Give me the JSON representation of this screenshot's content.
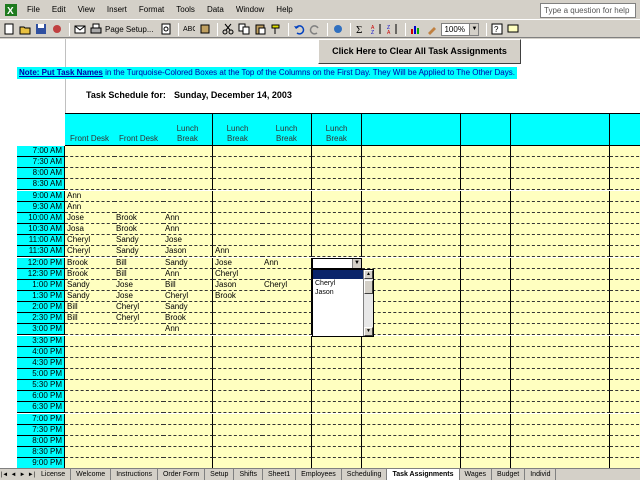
{
  "menu": {
    "items": [
      "File",
      "Edit",
      "View",
      "Insert",
      "Format",
      "Tools",
      "Data",
      "Window",
      "Help"
    ],
    "help_placeholder": "Type a question for help"
  },
  "toolbar": {
    "page_setup_label": "Page Setup...",
    "zoom": "100%",
    "icons": [
      "new-icon",
      "open-icon",
      "save-icon",
      "permission-icon",
      "email-icon",
      "print-icon",
      "print-preview-icon",
      "spelling-icon",
      "research-icon",
      "cut-icon",
      "copy-icon",
      "paste-icon",
      "format-painter-icon",
      "undo-icon",
      "redo-icon",
      "hyperlink-icon",
      "autosum-icon",
      "sort-ascending-icon",
      "sort-descending-icon",
      "chart-wizard-icon",
      "drawing-icon",
      "help-icon",
      "comment-icon"
    ]
  },
  "sheet": {
    "clear_button": "Click Here to Clear All Task Assignments",
    "note_bold": "Note: Put Task Names",
    "note_rest": " in the Turquoise-Colored Boxes at the Top of the Columns on the First Day. They Will be Applied to The Other Days.",
    "schedule_label": "Task Schedule for:",
    "schedule_date": "Sunday, December 14, 2003",
    "columns": [
      {
        "line1": "",
        "line2": "Front Desk"
      },
      {
        "line1": "",
        "line2": "Front Desk"
      },
      {
        "line1": "Lunch",
        "line2": "Break"
      },
      {
        "line1": "Lunch",
        "line2": "Break"
      },
      {
        "line1": "Lunch",
        "line2": "Break"
      },
      {
        "line1": "Lunch",
        "line2": "Break"
      },
      {
        "line1": "",
        "line2": ""
      },
      {
        "line1": "",
        "line2": ""
      },
      {
        "line1": "",
        "line2": ""
      },
      {
        "line1": "",
        "line2": ""
      },
      {
        "line1": "",
        "line2": ""
      },
      {
        "line1": "",
        "line2": ""
      }
    ],
    "rows": [
      {
        "time": "7:00 AM",
        "cells": [
          "",
          "",
          "",
          "",
          "",
          ""
        ]
      },
      {
        "time": "7:30 AM",
        "cells": [
          "",
          "",
          "",
          "",
          "",
          ""
        ]
      },
      {
        "time": "8:00 AM",
        "cells": [
          "",
          "",
          "",
          "",
          "",
          ""
        ]
      },
      {
        "time": "8:30 AM",
        "cells": [
          "",
          "",
          "",
          "",
          "",
          ""
        ]
      },
      {
        "time": "9:00 AM",
        "cells": [
          "Ann",
          "",
          "",
          "",
          "",
          ""
        ]
      },
      {
        "time": "9:30 AM",
        "cells": [
          "Ann",
          "",
          "",
          "",
          "",
          ""
        ]
      },
      {
        "time": "10:00 AM",
        "cells": [
          "Jose",
          "Brook",
          "Ann",
          "",
          "",
          ""
        ]
      },
      {
        "time": "10:30 AM",
        "cells": [
          "Josa",
          "Brook",
          "Ann",
          "",
          "",
          ""
        ]
      },
      {
        "time": "11:00 AM",
        "cells": [
          "Cheryl",
          "Sandy",
          "Jose",
          "",
          "",
          ""
        ]
      },
      {
        "time": "11:30 AM",
        "cells": [
          "Cheryl",
          "Sandy",
          "Jason",
          "Ann",
          "",
          ""
        ]
      },
      {
        "time": "12:00 PM",
        "cells": [
          "Brook",
          "Bill",
          "Sandy",
          "Jose",
          "Ann",
          ""
        ]
      },
      {
        "time": "12:30 PM",
        "cells": [
          "Brook",
          "Bill",
          "Ann",
          "Cheryl",
          "",
          ""
        ]
      },
      {
        "time": "1:00 PM",
        "cells": [
          "Sandy",
          "Jose",
          "Bill",
          "Jason",
          "Cheryl",
          ""
        ]
      },
      {
        "time": "1:30 PM",
        "cells": [
          "Sandy",
          "Jose",
          "Cheryl",
          "Brook",
          "",
          ""
        ]
      },
      {
        "time": "2:00 PM",
        "cells": [
          "Bill",
          "Cheryl",
          "Sandy",
          "",
          "",
          ""
        ]
      },
      {
        "time": "2:30 PM",
        "cells": [
          "Bill",
          "Cheryl",
          "Brook",
          "",
          "",
          ""
        ]
      },
      {
        "time": "3:00 PM",
        "cells": [
          "",
          "",
          "Ann",
          "",
          "",
          ""
        ]
      },
      {
        "time": "3:30 PM",
        "cells": [
          "",
          "",
          "",
          "",
          "",
          ""
        ]
      },
      {
        "time": "4:00 PM",
        "cells": [
          "",
          "",
          "",
          "",
          "",
          ""
        ]
      },
      {
        "time": "4:30 PM",
        "cells": [
          "",
          "",
          "",
          "",
          "",
          ""
        ]
      },
      {
        "time": "5:00 PM",
        "cells": [
          "",
          "",
          "",
          "",
          "",
          ""
        ]
      },
      {
        "time": "5:30 PM",
        "cells": [
          "",
          "",
          "",
          "",
          "",
          ""
        ]
      },
      {
        "time": "6:00 PM",
        "cells": [
          "",
          "",
          "",
          "",
          "",
          ""
        ]
      },
      {
        "time": "6:30 PM",
        "cells": [
          "",
          "",
          "",
          "",
          "",
          ""
        ]
      },
      {
        "time": "7:00 PM",
        "cells": [
          "",
          "",
          "",
          "",
          "",
          ""
        ]
      },
      {
        "time": "7:30 PM",
        "cells": [
          "",
          "",
          "",
          "",
          "",
          ""
        ]
      },
      {
        "time": "8:00 PM",
        "cells": [
          "",
          "",
          "",
          "",
          "",
          ""
        ]
      },
      {
        "time": "8:30 PM",
        "cells": [
          "",
          "",
          "",
          "",
          "",
          ""
        ]
      },
      {
        "time": "9:00 PM",
        "cells": [
          "",
          "",
          "",
          "",
          "",
          ""
        ]
      }
    ],
    "dropdown": {
      "items": [
        "",
        "Cheryl",
        "Jason"
      ],
      "selected_index": 0
    }
  },
  "tabs": {
    "items": [
      "License",
      "Welcome",
      "Instructions",
      "Order Form",
      "Setup",
      "Shifts",
      "Sheet1",
      "Employees",
      "Scheduling",
      "Task Assignments",
      "Wages",
      "Budget",
      "Individ"
    ],
    "active": "Task Assignments"
  },
  "colors": {
    "turquoise": "#00ffff",
    "cell_yellow": "#ffffc0",
    "note_text": "#0000aa",
    "selection": "#0a246a"
  }
}
